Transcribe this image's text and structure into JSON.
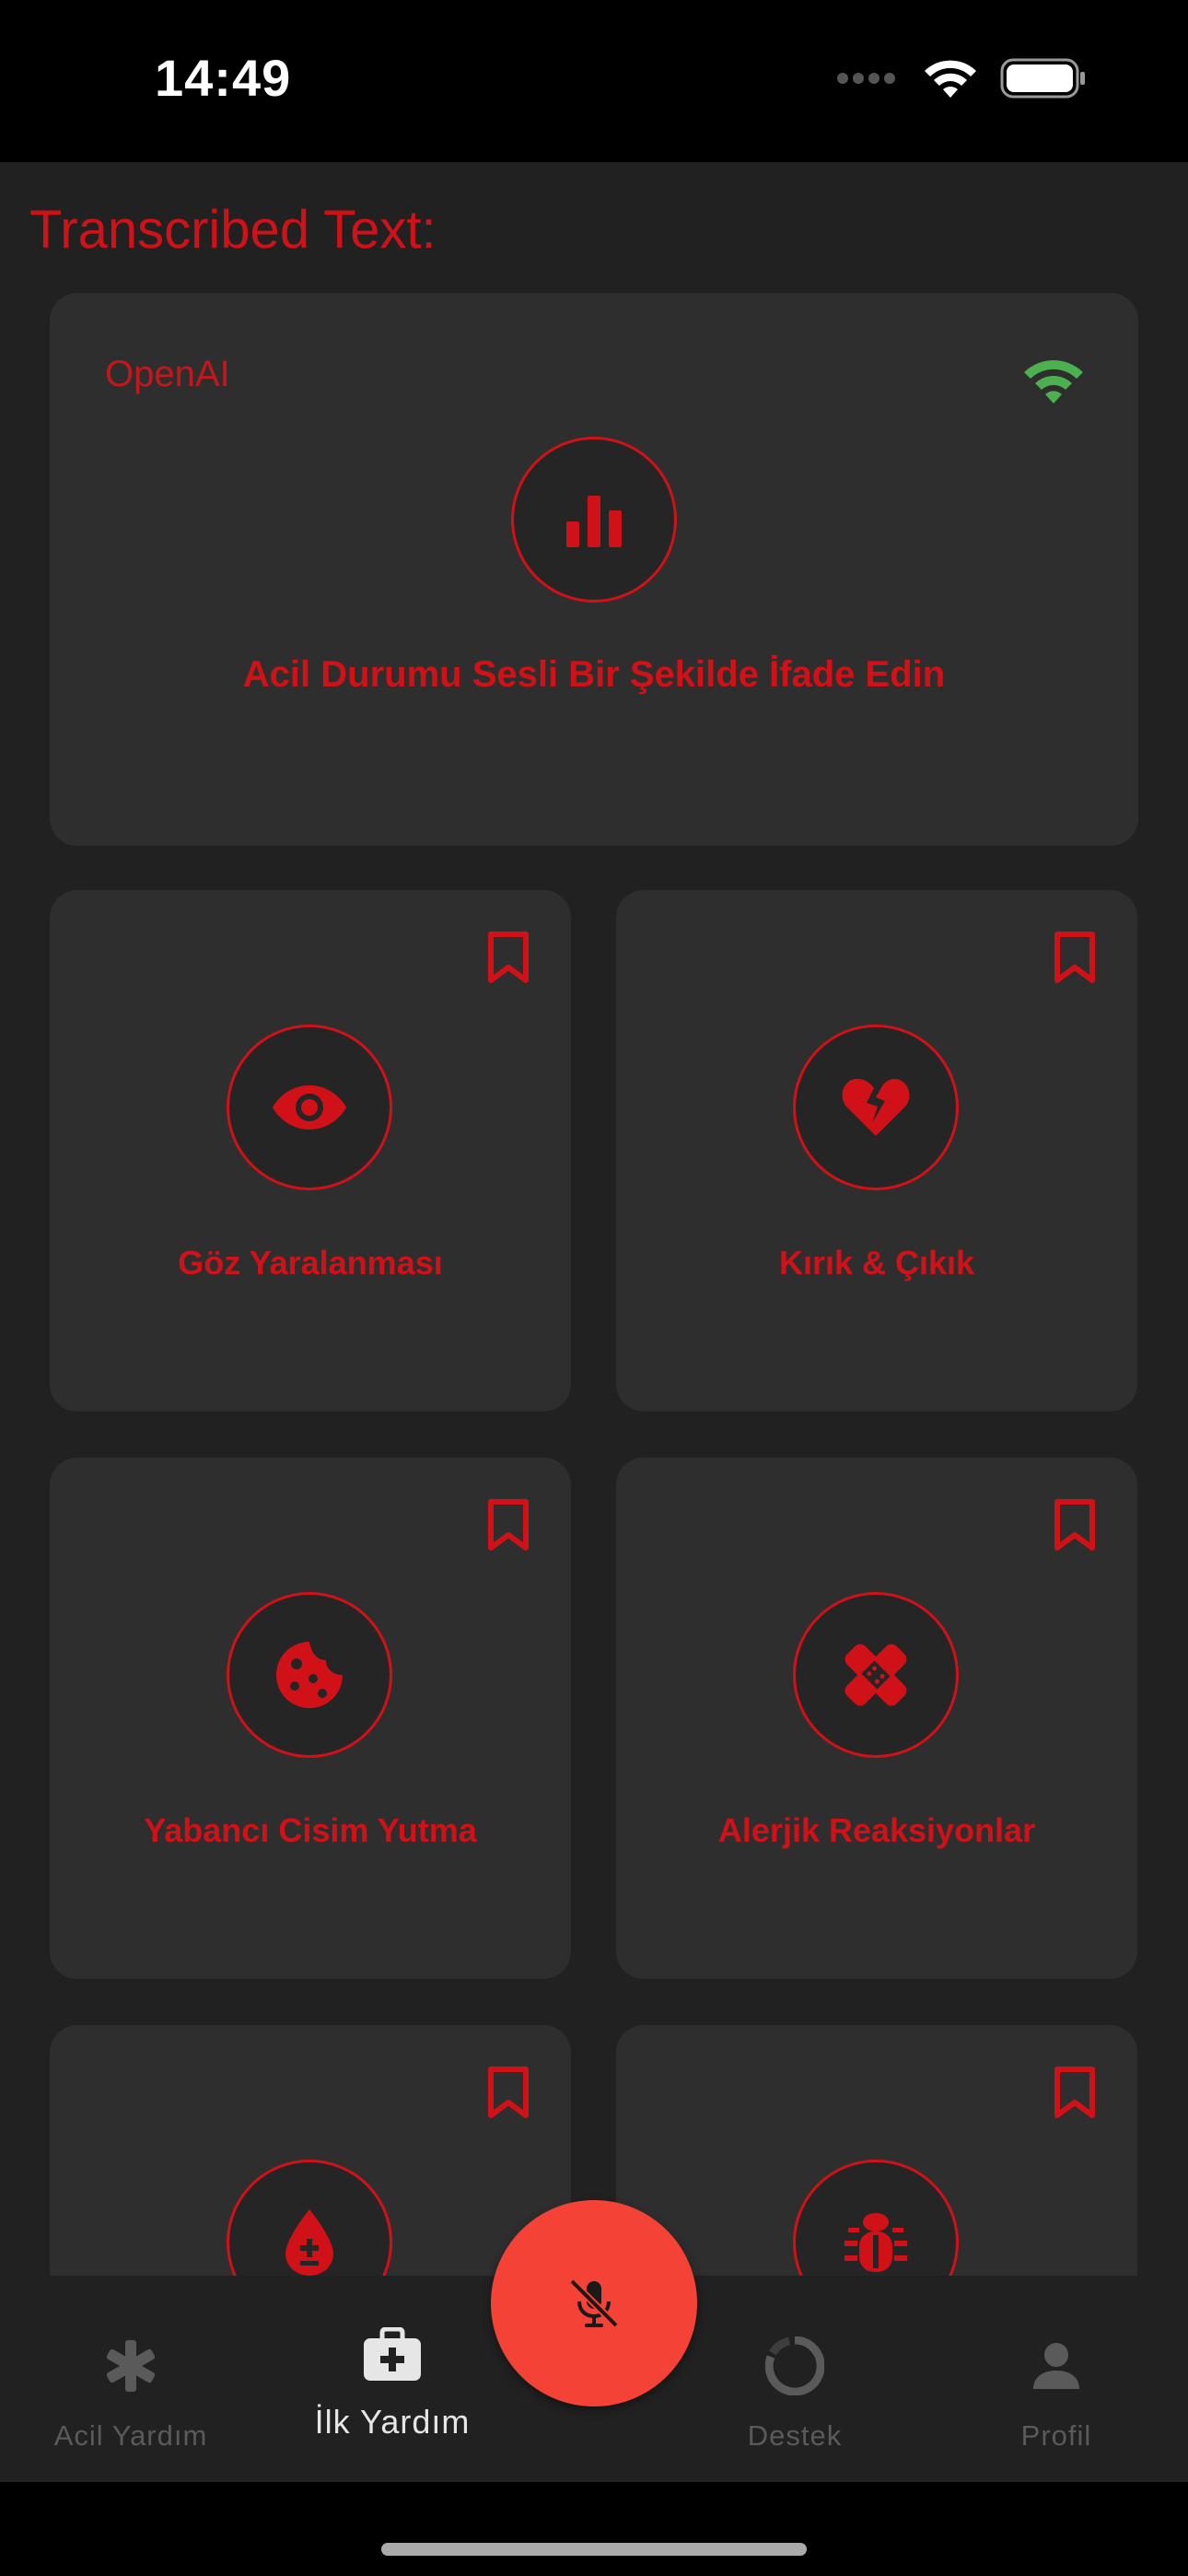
{
  "status_bar": {
    "time": "14:49"
  },
  "page": {
    "heading": "Transcribed Text:"
  },
  "hero": {
    "provider": "OpenAI",
    "icon": "bar-chart-icon",
    "label": "Acil Durumu Sesli Bir Şekilde İfade Edin"
  },
  "tiles": [
    {
      "label": "Göz Yaralanması",
      "icon": "eye-icon"
    },
    {
      "label": "Kırık & Çıkık",
      "icon": "broken-heart-icon"
    },
    {
      "label": "Yabancı Cisim Yutma",
      "icon": "cookie-icon"
    },
    {
      "label": "Alerjik Reaksiyonlar",
      "icon": "bandage-icon"
    },
    {
      "label": "",
      "icon": "blood-drop-icon"
    },
    {
      "label": "",
      "icon": "bug-icon"
    }
  ],
  "nav": {
    "items": [
      {
        "label": "Acil Yardım",
        "icon": "asterisk-icon"
      },
      {
        "label": "İlk Yardım",
        "icon": "first-aid-kit-icon"
      },
      {
        "label": "Destek",
        "icon": "spinner-icon"
      },
      {
        "label": "Profil",
        "icon": "person-icon"
      }
    ],
    "active_index": 1
  },
  "fab": {
    "icon": "microphone-slash-icon"
  },
  "colors": {
    "accent": "#d01218",
    "fab": "#f44336",
    "wifi": "#4caf50",
    "background": "#212121",
    "card": "#2e2e2e"
  }
}
